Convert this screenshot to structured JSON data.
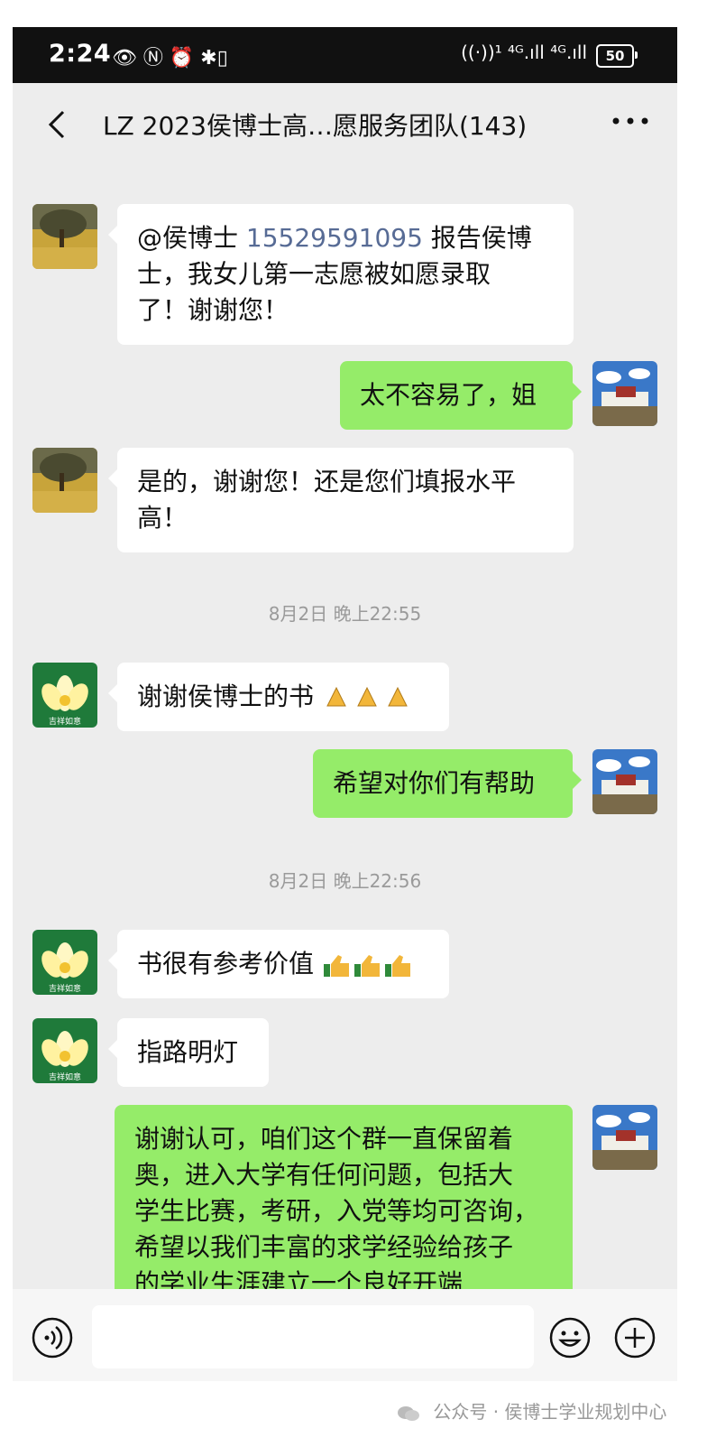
{
  "status_bar": {
    "time": "2:24",
    "left_icons": "👁 Ⓝ ⏰ ✱▯",
    "right_icons": "((·))¹ ⁴ᴳ.ıll ⁴ᴳ.ıll",
    "battery": "50"
  },
  "nav": {
    "title": "LZ 2023侯博士高…愿服务团队(143)"
  },
  "messages": [
    {
      "mention": "@侯博士",
      "phone": "15529591095",
      "line1_rest": " 报告侯博",
      "line2": "士，我女儿第一志愿被如愿录取",
      "line3": "了！谢谢您！"
    },
    {
      "text": "太不容易了，姐"
    },
    {
      "line1": "是的，谢谢您！还是您们填报水平",
      "line2": "高！"
    },
    {
      "text": "谢谢侯博士的书"
    },
    {
      "text": "希望对你们有帮助"
    },
    {
      "text": "书很有参考价值"
    },
    {
      "text": "指路明灯"
    },
    {
      "line1": "谢谢认可，咱们这个群一直保留着",
      "line2": "奥，进入大学有任何问题，包括大",
      "line3": "学生比赛，考研，入党等均可咨询，",
      "line4": "希望以我们丰富的求学经验给孩子",
      "line5": "的学业生涯建立一个良好开端"
    }
  ],
  "timestamps": [
    "8月2日 晚上22:55",
    "8月2日 晚上22:56"
  ],
  "avatar_labels": [
    "吉祥如意",
    "吉祥如意",
    "吉祥如意"
  ],
  "watermark": "公众号 · 侯博士学业规划中心",
  "colors": {
    "outgoing_bubble": "#95ec69",
    "incoming_bubble": "#ffffff",
    "chat_background": "#ededed",
    "link": "#576b95"
  },
  "icons": {
    "back": "chevron-left-icon",
    "more": "more-icon",
    "voice": "voice-icon",
    "emoji": "emoji-icon",
    "plus": "plus-icon",
    "pray": "pray-emoji",
    "thumbs_up": "thumbs-up-emoji"
  }
}
